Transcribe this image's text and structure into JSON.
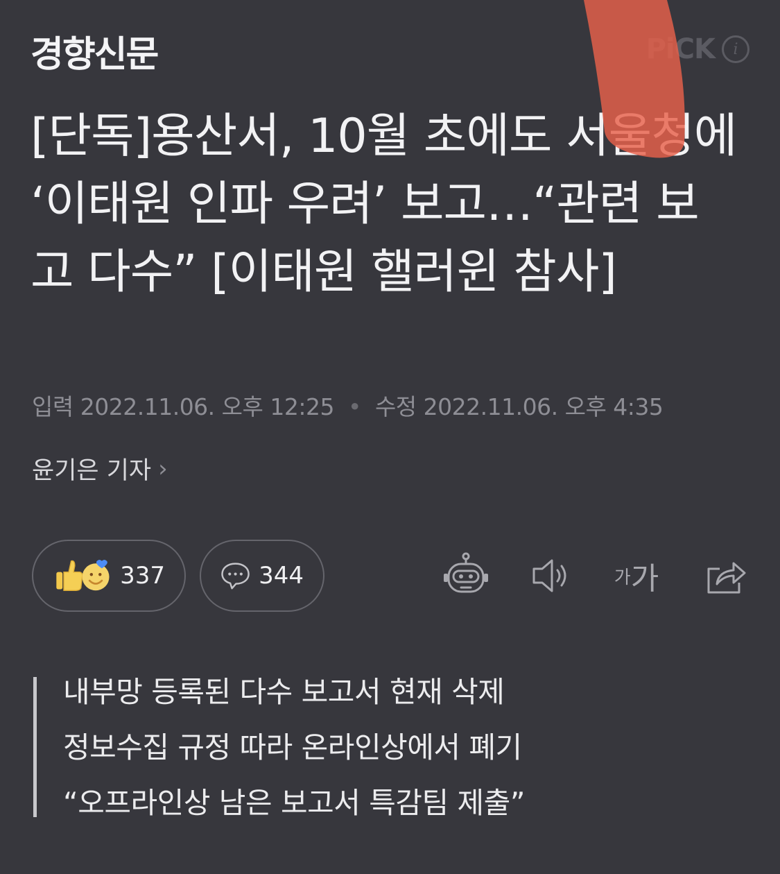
{
  "header": {
    "logo": "경향신문",
    "pick": "PiCK"
  },
  "article": {
    "headline": "[단독]용산서, 10월 초에도 서울청에 ‘이태원 인파 우려’ 보고…“관련 보고 다수” [이태원 핼러윈 참사]",
    "input_label": "입력",
    "input_time": "2022.11.06. 오후 12:25",
    "modified_label": "수정",
    "modified_time": "2022.11.06. 오후 4:35",
    "reporter": "윤기은 기자"
  },
  "actions": {
    "reaction_count": "337",
    "comment_count": "344",
    "font_small": "가",
    "font_large": "가"
  },
  "summary": [
    "내부망 등록된 다수 보고서 현재 삭제",
    "정보수집 규정 따라 온라인상에서 폐기",
    "“오프라인상 남은 보고서 특감팀 제출”"
  ],
  "colors": {
    "background": "#37373d",
    "text": "#f2f2f4",
    "muted": "#8e8e95",
    "highlight_stroke": "#e8604a"
  },
  "icons": [
    "info-icon",
    "thumbs-up-icon",
    "smile-icon",
    "comment-icon",
    "robot-icon",
    "speaker-icon",
    "share-icon",
    "chevron-right-icon"
  ]
}
